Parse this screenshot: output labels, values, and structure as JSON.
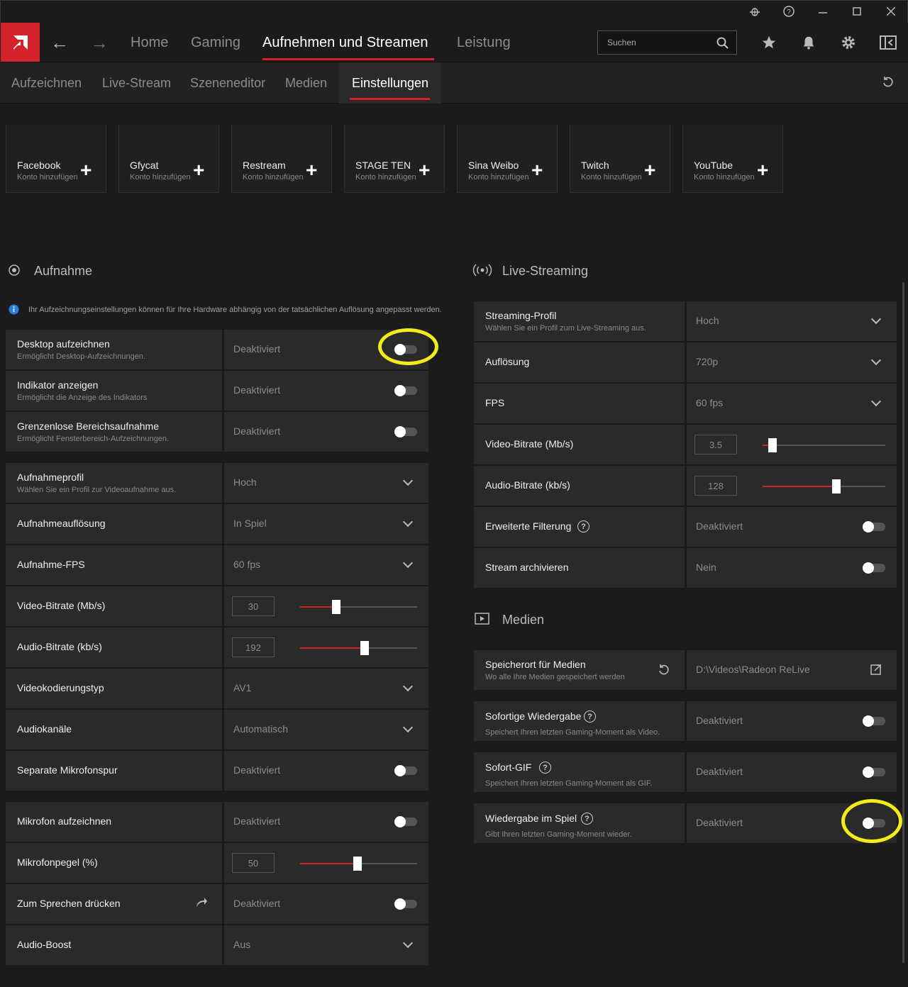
{
  "nav": {
    "tabs": [
      "Home",
      "Gaming",
      "Aufnehmen und Streamen",
      "Leistung"
    ],
    "search_placeholder": "Suchen"
  },
  "subnav": {
    "tabs": [
      "Aufzeichnen",
      "Live-Stream",
      "Szeneneditor",
      "Medien",
      "Einstellungen"
    ]
  },
  "accounts": [
    {
      "name": "Facebook",
      "sub": "Konto hinzufügen"
    },
    {
      "name": "Gfycat",
      "sub": "Konto hinzufügen"
    },
    {
      "name": "Restream",
      "sub": "Konto hinzufügen"
    },
    {
      "name": "STAGE TEN",
      "sub": "Konto hinzufügen"
    },
    {
      "name": "Sina Weibo",
      "sub": "Konto hinzufügen"
    },
    {
      "name": "Twitch",
      "sub": "Konto hinzufügen"
    },
    {
      "name": "YouTube",
      "sub": "Konto hinzufügen"
    }
  ],
  "aufnahme": {
    "title": "Aufnahme",
    "info": "Ihr Aufzeichnungseinstellungen können für Ihre Hardware abhängig von der tatsächlichen Auflösung angepasst werden.",
    "group1": [
      {
        "label": "Desktop aufzeichnen",
        "desc": "Ermöglicht Desktop-Aufzeichnungen.",
        "value": "Deaktiviert"
      },
      {
        "label": "Indikator anzeigen",
        "desc": "Ermöglicht die Anzeige des Indikators",
        "value": "Deaktiviert"
      },
      {
        "label": "Grenzenlose Bereichsaufnahme",
        "desc": "Ermöglicht Fensterbereich-Aufzeichnungen.",
        "value": "Deaktiviert"
      }
    ],
    "group2": [
      {
        "label": "Aufnahmeprofil",
        "desc": "Wählen Sie ein Profil zur Videoaufnahme aus.",
        "value": "Hoch"
      },
      {
        "label": "Aufnahmeauflösung",
        "value": "In Spiel"
      },
      {
        "label": "Aufnahme-FPS",
        "value": "60 fps"
      },
      {
        "label": "Video-Bitrate (Mb/s)",
        "value": "30",
        "slider": 0.31
      },
      {
        "label": "Audio-Bitrate (kb/s)",
        "value": "192",
        "slider": 0.55
      },
      {
        "label": "Videokodierungstyp",
        "value": "AV1"
      },
      {
        "label": "Audiokanäle",
        "value": "Automatisch"
      },
      {
        "label": "Separate Mikrofonspur",
        "value": "Deaktiviert"
      }
    ],
    "group3": [
      {
        "label": "Mikrofon aufzeichnen",
        "value": "Deaktiviert"
      },
      {
        "label": "Mikrofonpegel (%)",
        "value": "50",
        "slider": 0.49
      },
      {
        "label": "Zum Sprechen drücken",
        "value": "Deaktiviert"
      },
      {
        "label": "Audio-Boost",
        "value": "Aus"
      }
    ]
  },
  "live": {
    "title": "Live-Streaming",
    "rows": [
      {
        "label": "Streaming-Profil",
        "desc": "Wählen Sie ein Profil zum Live-Streaming aus.",
        "value": "Hoch"
      },
      {
        "label": "Auflösung",
        "value": "720p"
      },
      {
        "label": "FPS",
        "value": "60 fps"
      },
      {
        "label": "Video-Bitrate (Mb/s)",
        "value": "3.5",
        "slider": 0.08
      },
      {
        "label": "Audio-Bitrate (kb/s)",
        "value": "128",
        "slider": 0.6
      },
      {
        "label": "Erweiterte Filterung",
        "value": "Deaktiviert"
      },
      {
        "label": "Stream archivieren",
        "value": "Nein"
      }
    ]
  },
  "medien": {
    "title": "Medien",
    "rows": [
      {
        "label": "Speicherort für Medien",
        "desc": "Wo alle Ihre Medien gespeichert werden",
        "value": "D:\\Videos\\Radeon ReLive"
      },
      {
        "label": "Sofortige Wiedergabe",
        "desc": "Speichert Ihren letzten Gaming-Moment als Video.",
        "value": "Deaktiviert"
      },
      {
        "label": "Sofort-GIF",
        "desc": "Speichert Ihren letzten Gaming-Moment als GIF.",
        "value": "Deaktiviert"
      },
      {
        "label": "Wiedergabe im Spiel",
        "desc": "Gibt Ihren letzten Gaming-Moment wieder.",
        "value": "Deaktiviert"
      }
    ]
  },
  "colors": {
    "accent": "#d3222a",
    "highlight": "#f5eb1a"
  }
}
